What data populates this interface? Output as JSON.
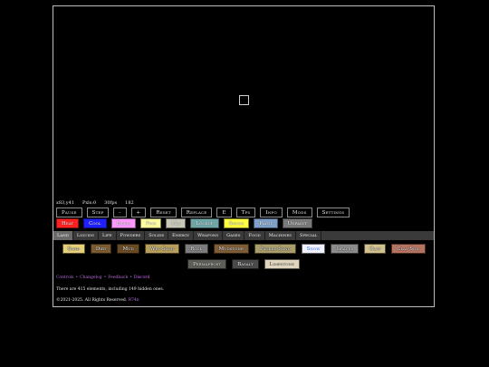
{
  "stats": {
    "coords": "x83,y41",
    "pixels": "Pxls:0",
    "fps": "30fps",
    "tick": "182"
  },
  "controls": [
    {
      "name": "pause-button",
      "label": "Pause"
    },
    {
      "name": "step-button",
      "label": "Step"
    },
    {
      "name": "decrease-brush-button",
      "label": "-"
    },
    {
      "name": "increase-brush-button",
      "label": "+"
    },
    {
      "name": "reset-button",
      "label": "Reset"
    },
    {
      "name": "replace-button",
      "label": "Replace"
    },
    {
      "name": "e-button",
      "label": "E"
    },
    {
      "name": "tps-button",
      "label": "Tps"
    },
    {
      "name": "info-button",
      "label": "Info"
    },
    {
      "name": "mods-button",
      "label": "Mods"
    },
    {
      "name": "settings-button",
      "label": "Settings"
    }
  ],
  "tools": [
    {
      "label": "Heat",
      "color": "#ff2020"
    },
    {
      "label": "Cool",
      "color": "#2020ff"
    },
    {
      "label": "Erase",
      "color": "#ff99ff"
    },
    {
      "label": "Pick",
      "color": "#ffffa0"
    },
    {
      "label": "Mix",
      "color": "#c8c8b8"
    },
    {
      "label": "Lookup",
      "color": "#6fa7a7"
    },
    {
      "label": "Shock",
      "color": "#ffff40"
    },
    {
      "label": "Paint",
      "color": "#7fa0c8"
    },
    {
      "label": "Unpaint",
      "color": "#7a7a7a"
    }
  ],
  "categories": [
    {
      "label": "Land",
      "active": true
    },
    {
      "label": "Liquids",
      "active": false
    },
    {
      "label": "Life",
      "active": false
    },
    {
      "label": "Powders",
      "active": false
    },
    {
      "label": "Solids",
      "active": false
    },
    {
      "label": "Energy",
      "active": false
    },
    {
      "label": "Weapons",
      "active": false
    },
    {
      "label": "Gases",
      "active": false
    },
    {
      "label": "Food",
      "active": false
    },
    {
      "label": "Machines",
      "active": false
    },
    {
      "label": "Special",
      "active": false
    }
  ],
  "elements": [
    {
      "label": "Sand",
      "color": "#e6d07a"
    },
    {
      "label": "Dirt",
      "color": "#7a5a2e"
    },
    {
      "label": "Mud",
      "color": "#6a4a22"
    },
    {
      "label": "Wet Sand",
      "color": "#b89e5a"
    },
    {
      "label": "Rock",
      "color": "#7d7d7d"
    },
    {
      "label": "Mudstone",
      "color": "#7e5c36"
    },
    {
      "label": "Packed Sand",
      "color": "#a99d6a"
    },
    {
      "label": "Snow",
      "color": "#f2f2ff"
    },
    {
      "label": "Gravel",
      "color": "#8b8b8b"
    },
    {
      "label": "Clay",
      "color": "#d3c28e"
    },
    {
      "label": "Clay Soil",
      "color": "#b6735f"
    },
    {
      "label": "Permafrost",
      "color": "#5e5e58"
    },
    {
      "label": "Basalt",
      "color": "#4a4a4a"
    },
    {
      "label": "Limestone",
      "color": "#e0d6c0"
    }
  ],
  "links": {
    "controls": "Controls",
    "changelog": "Changelog",
    "feedback": "Feedback",
    "discord": "Discord",
    "separator": "•"
  },
  "element_count": "There are 415 elements, including 149 hidden ones.",
  "copyright": {
    "text": "©2021-2025. All Rights Reserved.",
    "owner": "R74n"
  }
}
